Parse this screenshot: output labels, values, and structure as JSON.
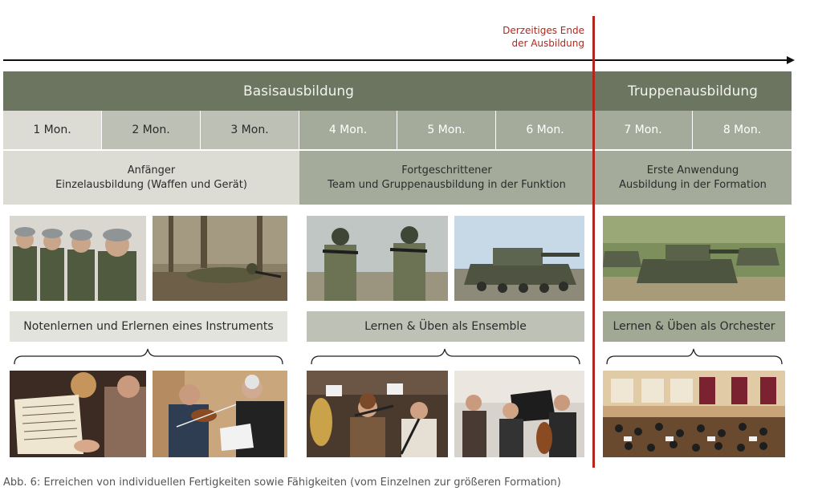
{
  "end_note": {
    "line1": "Derzeitiges Ende",
    "line2": "der Ausbildung"
  },
  "phases": {
    "basis": "Basisausbildung",
    "truppe": "Truppenausbildung"
  },
  "months": [
    "1 Mon.",
    "2 Mon.",
    "3 Mon.",
    "4 Mon.",
    "5 Mon.",
    "6 Mon.",
    "7 Mon.",
    "8 Mon."
  ],
  "levels": [
    {
      "title": "Anfänger",
      "desc": "Einzelausbildung (Waffen und Gerät)"
    },
    {
      "title": "Fortgeschrittener",
      "desc": "Team und Gruppenausbildung in der Funktion"
    },
    {
      "title": "Erste Anwendung",
      "desc": "Ausbildung in der Formation"
    }
  ],
  "music_labels": [
    "Notenlernen und Erlernen eines Instruments",
    "Lernen & Üben als Ensemble",
    "Lernen & Üben als Orchester"
  ],
  "photos": {
    "soldiers_lineup": "soldiers-in-line-photo",
    "soldier_prone": "soldier-prone-forest-photo",
    "soldiers_aiming": "soldiers-aiming-photo",
    "tank_1": "tank-photo",
    "tanks_formation": "tanks-formation-photo",
    "sheet_music": "sheet-music-reading-photo",
    "violin_lesson": "violin-lesson-photo",
    "ensemble_winds": "wind-ensemble-photo",
    "ensemble_strings": "string-ensemble-photo",
    "orchestra_hall": "orchestra-hall-photo"
  },
  "caption": "Abb. 6: Erreichen von individuellen Fertigkeiten sowie Fähigkeiten (vom Einzelnen zur größeren Formation)",
  "colors": {
    "dark_olive": "#6b7560",
    "mid_olive": "#a4ab9b",
    "light_grey": "#dcdcd5",
    "mid_grey": "#bdc0b5",
    "red_line": "#b3261e"
  }
}
